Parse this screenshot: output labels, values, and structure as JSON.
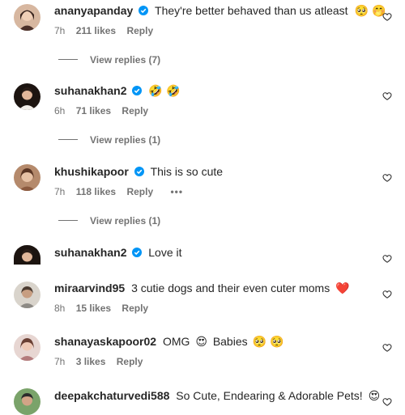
{
  "comments": [
    {
      "username": "ananyapanday",
      "text": "They're better behaved than us atleast",
      "emoji": "🥺 🤭",
      "time": "7h",
      "likes": "211 likes",
      "reply": "Reply",
      "view_replies": "View replies (7)"
    },
    {
      "username": "suhanakhan2",
      "text": "",
      "emoji": "🤣 🤣",
      "time": "6h",
      "likes": "71 likes",
      "reply": "Reply",
      "view_replies": "View replies (1)"
    },
    {
      "username": "khushikapoor",
      "text": "This is so cute",
      "emoji": "",
      "time": "7h",
      "likes": "118 likes",
      "reply": "Reply",
      "more": "•••",
      "view_replies": "View replies (1)"
    },
    {
      "username": "suhanakhan2",
      "text": "Love it",
      "emoji": ""
    },
    {
      "username": "miraarvind95",
      "text": "3 cutie dogs and their even cuter moms",
      "emoji": "❤️",
      "time": "8h",
      "likes": "15 likes",
      "reply": "Reply"
    },
    {
      "username": "shanayaskapoor02",
      "text": "OMG",
      "emoji_mid": "😍",
      "text2": "Babies",
      "emoji": "🥺 🥺",
      "time": "7h",
      "likes": "3 likes",
      "reply": "Reply"
    },
    {
      "username": "deepakchaturvedi588",
      "text": "So Cute, Endearing & Adorable Pets!",
      "emoji": "😍"
    }
  ],
  "colors": {
    "verified": "#0095f6",
    "text": "#262626",
    "secondary": "#737373",
    "heart_red": "#ed4956"
  },
  "icons": {
    "verified": "verified-badge-icon",
    "like": "heart-outline-icon",
    "more": "more-options-icon"
  }
}
